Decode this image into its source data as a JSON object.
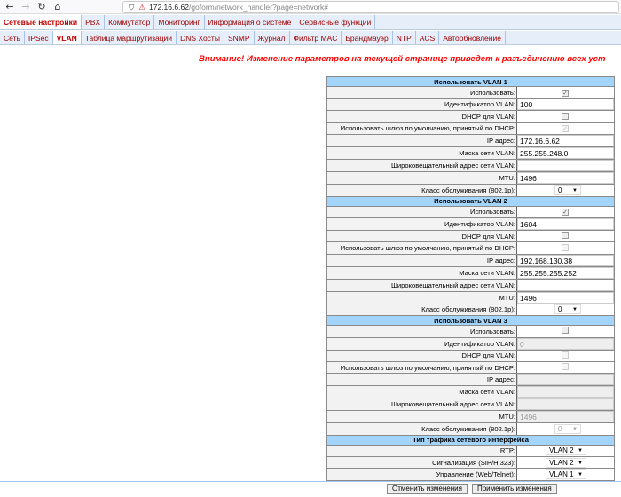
{
  "browser": {
    "url_host": "172.16.6.62",
    "url_path": "/goform/network_handler?page=network#"
  },
  "menu_main": [
    "Сетевые настройки",
    "PBX",
    "Коммутатор",
    "Мониторинг",
    "Информация о системе",
    "Сервисные функции"
  ],
  "menu_sub": [
    "Сеть",
    "IPSec",
    "VLAN",
    "Таблица маршрутизации",
    "DNS Хосты",
    "SNMP",
    "Журнал",
    "Фильтр MAC",
    "Брандмауэр",
    "NTP",
    "ACS",
    "Автообновление"
  ],
  "warning": "Внимание! Изменение параметров на текущей странице приведет к разъединению всех уст",
  "sections": [
    {
      "title": "Использовать VLAN 1",
      "rows": [
        {
          "label": "Использовать:",
          "type": "check",
          "checked": true,
          "disabled": false
        },
        {
          "label": "Идентификатор VLAN:",
          "type": "text",
          "value": "100",
          "disabled": false
        },
        {
          "label": "DHCP для VLAN:",
          "type": "check",
          "checked": false,
          "disabled": false
        },
        {
          "label": "Использовать шлюз по умолчанию, принятый по DHCP:",
          "type": "check",
          "checked": true,
          "disabled": true
        },
        {
          "label": "IP адрес:",
          "type": "text",
          "value": "172.16.6.62",
          "disabled": false
        },
        {
          "label": "Маска сети VLAN:",
          "type": "text",
          "value": "255.255.248.0",
          "disabled": false
        },
        {
          "label": "Широковещательный адрес сети VLAN:",
          "type": "text",
          "value": "",
          "disabled": false
        },
        {
          "label": "MTU:",
          "type": "text",
          "value": "1496",
          "disabled": false
        },
        {
          "label": "Класс обслуживания (802.1p):",
          "type": "select",
          "value": "0",
          "disabled": false
        }
      ]
    },
    {
      "title": "Использовать VLAN 2",
      "rows": [
        {
          "label": "Использовать:",
          "type": "check",
          "checked": true,
          "disabled": false
        },
        {
          "label": "Идентификатор VLAN:",
          "type": "text",
          "value": "1604",
          "disabled": false
        },
        {
          "label": "DHCP для VLAN:",
          "type": "check",
          "checked": false,
          "disabled": false
        },
        {
          "label": "Использовать шлюз по умолчанию, принятый по DHCP:",
          "type": "check",
          "checked": false,
          "disabled": true
        },
        {
          "label": "IP адрес:",
          "type": "text",
          "value": "192.168.130.38",
          "disabled": false
        },
        {
          "label": "Маска сети VLAN:",
          "type": "text",
          "value": "255.255.255.252",
          "disabled": false
        },
        {
          "label": "Широковещательный адрес сети VLAN:",
          "type": "text",
          "value": "",
          "disabled": false
        },
        {
          "label": "MTU:",
          "type": "text",
          "value": "1496",
          "disabled": false
        },
        {
          "label": "Класс обслуживания (802.1p):",
          "type": "select",
          "value": "0",
          "disabled": false
        }
      ]
    },
    {
      "title": "Использовать VLAN 3",
      "rows": [
        {
          "label": "Использовать:",
          "type": "check",
          "checked": false,
          "disabled": false
        },
        {
          "label": "Идентификатор VLAN:",
          "type": "text",
          "value": "0",
          "disabled": true
        },
        {
          "label": "DHCP для VLAN:",
          "type": "check",
          "checked": false,
          "disabled": true
        },
        {
          "label": "Использовать шлюз по умолчанию, принятый по DHCP:",
          "type": "check",
          "checked": false,
          "disabled": true
        },
        {
          "label": "IP адрес:",
          "type": "text",
          "value": "",
          "disabled": true
        },
        {
          "label": "Маска сети VLAN:",
          "type": "text",
          "value": "",
          "disabled": true
        },
        {
          "label": "Широковещательный адрес сети VLAN:",
          "type": "text",
          "value": "",
          "disabled": true
        },
        {
          "label": "MTU:",
          "type": "text",
          "value": "1496",
          "disabled": true
        },
        {
          "label": "Класс обслуживания (802.1p):",
          "type": "select",
          "value": "0",
          "disabled": true
        }
      ]
    },
    {
      "title": "Тип трафика сетевого интерфейса",
      "rows": [
        {
          "label": "RTP:",
          "type": "select",
          "value": "VLAN 2",
          "disabled": false,
          "wide": true
        },
        {
          "label": "Сигнализация (SIP/H.323):",
          "type": "select",
          "value": "VLAN 2",
          "disabled": false,
          "wide": true
        },
        {
          "label": "Управление (Web/Telnet):",
          "type": "select",
          "value": "VLAN 1",
          "disabled": false,
          "wide": true
        }
      ]
    }
  ],
  "buttons": {
    "cancel": "Отменить изменения",
    "apply": "Применить изменения"
  },
  "colors": {
    "accent": "#a00000",
    "header": "#a3d4fb",
    "warning": "#ff0000"
  }
}
